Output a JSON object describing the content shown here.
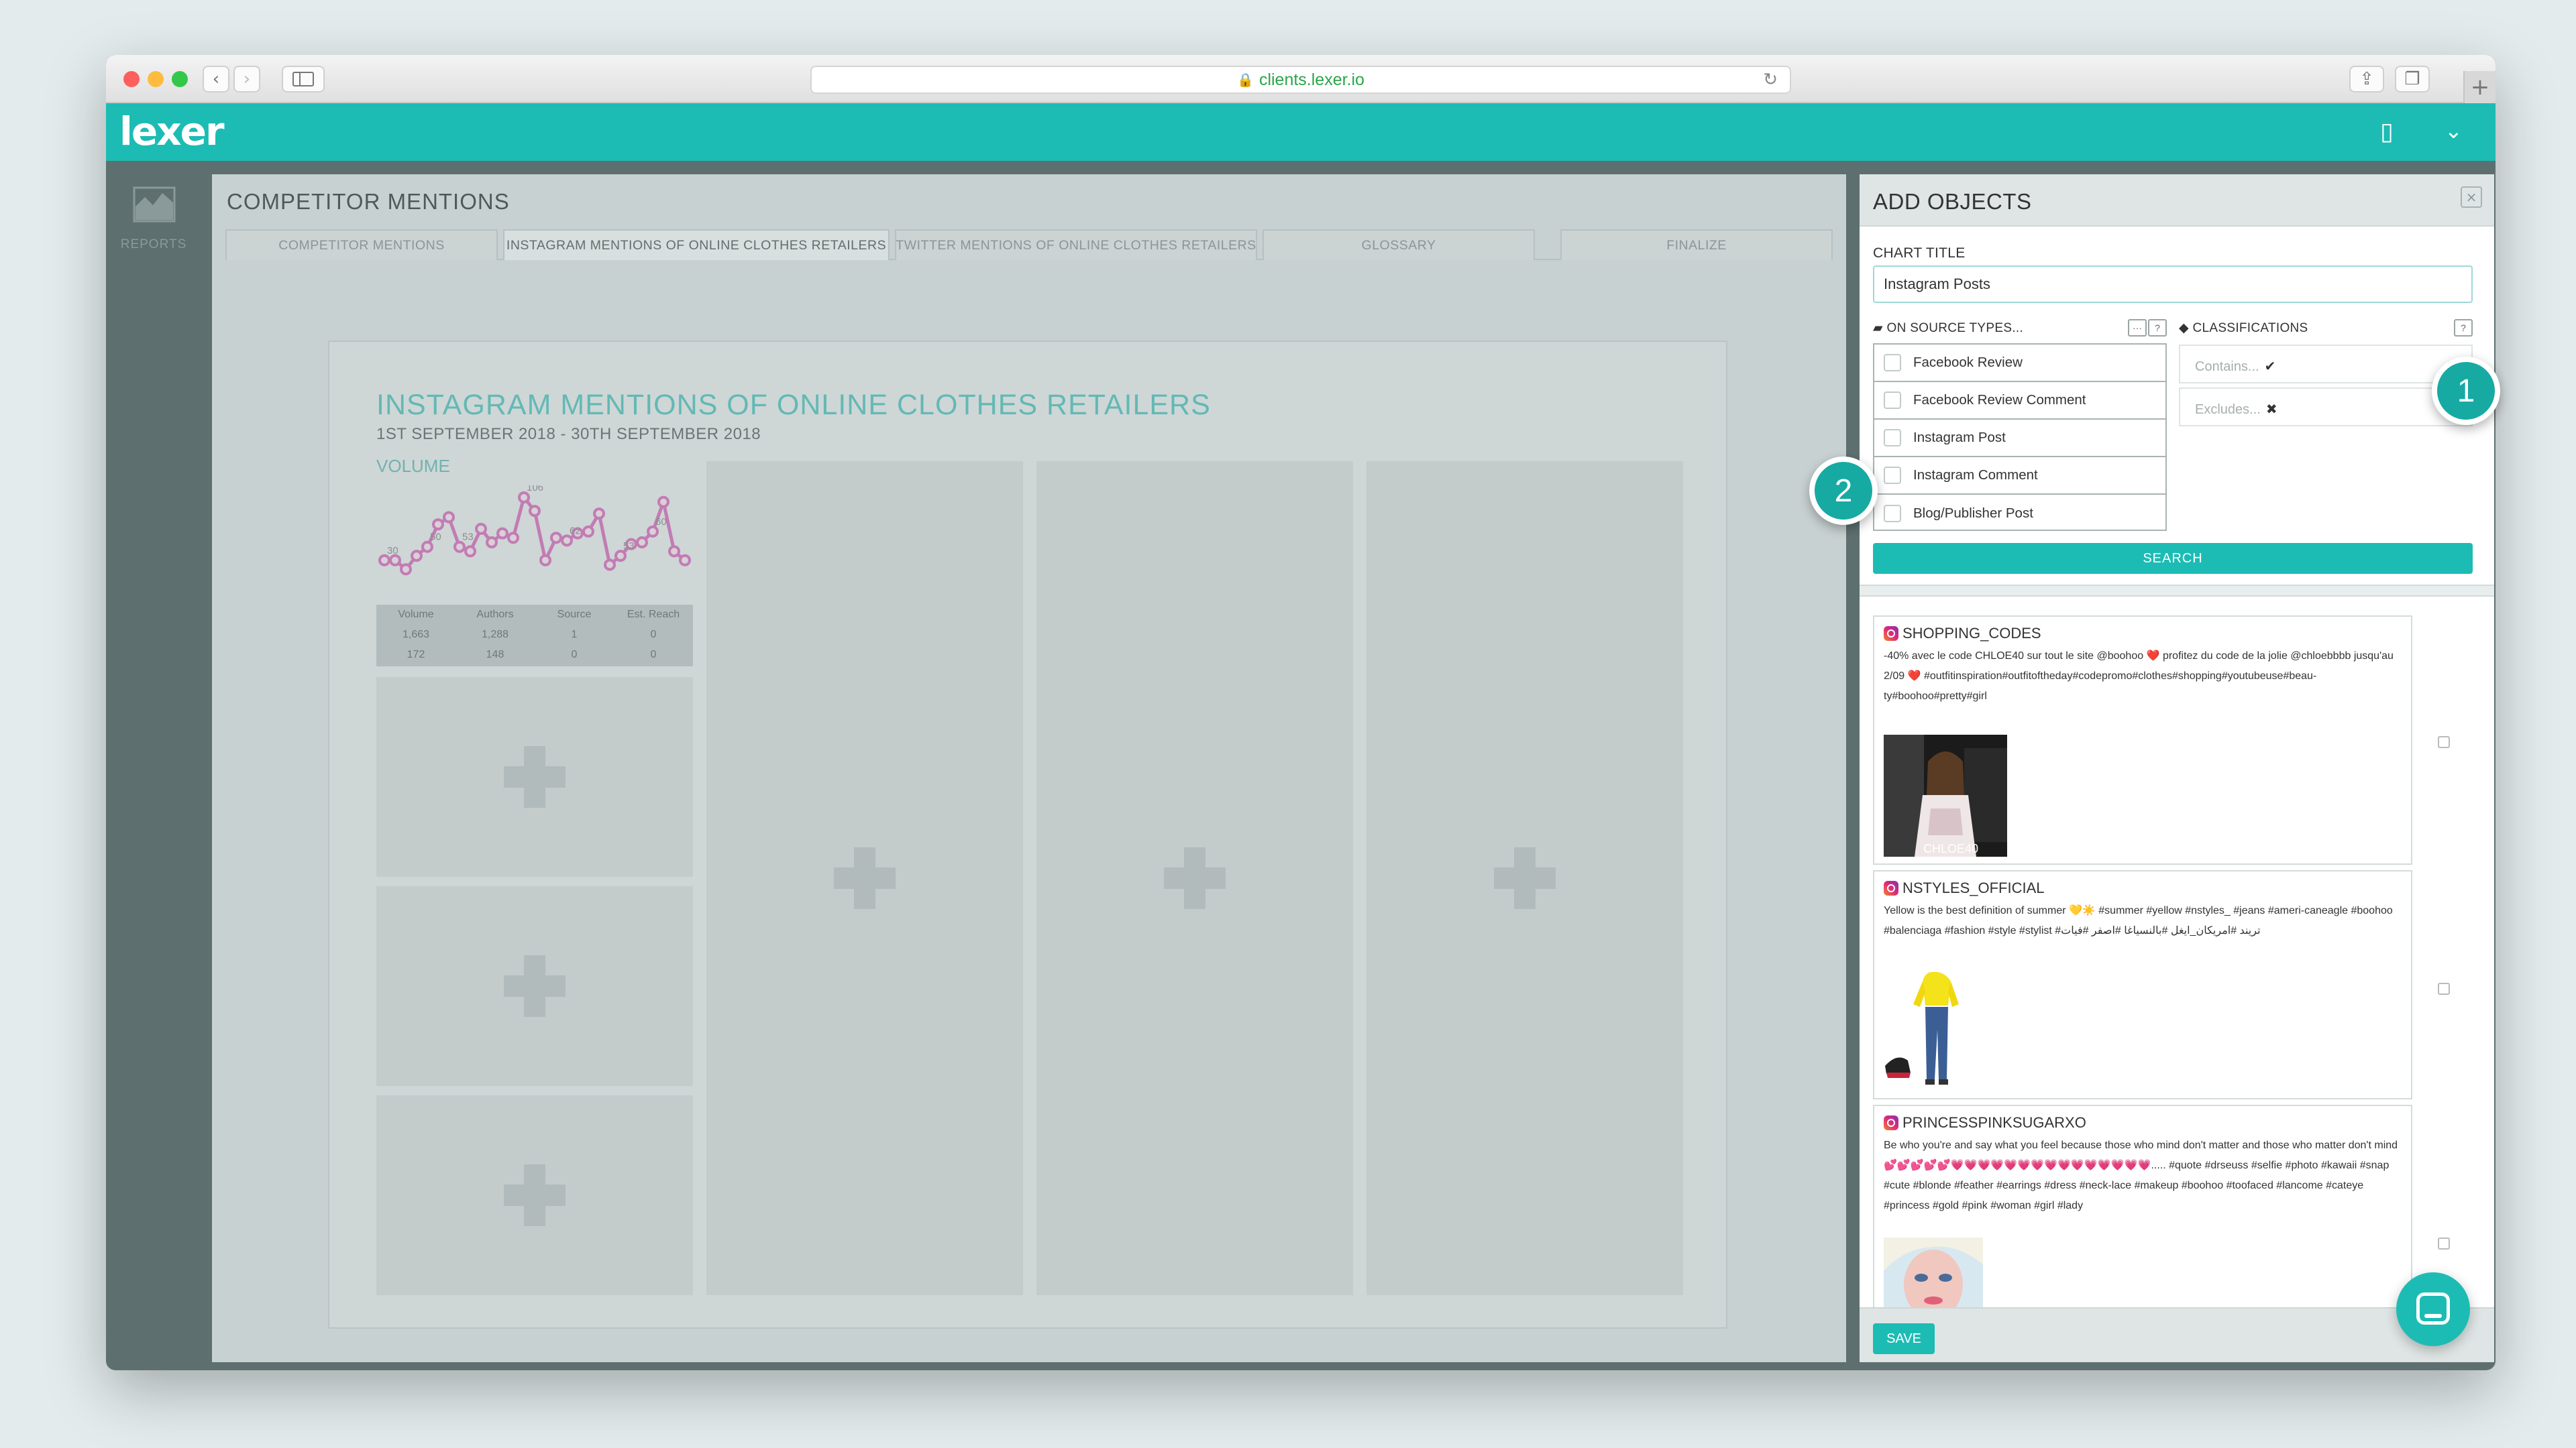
{
  "browser": {
    "url": "clients.lexer.io"
  },
  "app": {
    "logo": "lexer"
  },
  "sidebar": {
    "reports_label": "REPORTS"
  },
  "main": {
    "title": "COMPETITOR MENTIONS",
    "tabs": [
      {
        "label": "COMPETITOR MENTIONS"
      },
      {
        "label": "INSTAGRAM MENTIONS OF ONLINE CLOTHES RETAILERS"
      },
      {
        "label": "TWITTER MENTIONS OF ONLINE CLOTHES RETAILERS"
      },
      {
        "label": "GLOSSARY"
      },
      {
        "label": "FINALIZE"
      }
    ],
    "active_tab": 1,
    "report": {
      "title": "INSTAGRAM MENTIONS OF ONLINE CLOTHES RETAILERS",
      "date_range": "1ST SEPTEMBER 2018 - 30TH SEPTEMBER 2018",
      "widget_title": "VOLUME",
      "stats": {
        "headers": [
          "Volume",
          "Authors",
          "Source",
          "Est. Reach"
        ],
        "rows": [
          [
            "1,663",
            "1,288",
            "1",
            "0"
          ],
          [
            "172",
            "148",
            "0",
            "0"
          ]
        ]
      }
    }
  },
  "chart_data": {
    "type": "line",
    "title": "VOLUME",
    "series": [
      {
        "values": [
          30,
          30,
          20,
          35,
          45,
          70,
          78,
          45,
          40,
          65,
          50,
          60,
          55,
          100,
          85,
          30,
          55,
          52,
          60,
          62,
          82,
          25,
          35,
          48,
          50,
          62,
          95,
          40,
          30
        ]
      }
    ],
    "data_labels": [
      "30",
      "50",
      "53",
      "106",
      "62",
      "53",
      "60"
    ],
    "color": "#c27cb4"
  },
  "panel": {
    "title": "ADD OBJECTS",
    "close_icon": "×",
    "chart_title_label": "CHART TITLE",
    "chart_title_value": "Instagram Posts",
    "source_types_label": "ON SOURCE TYPES...",
    "source_more": "···",
    "help": "?",
    "classifications_label": "CLASSIFICATIONS",
    "source_types": [
      {
        "label": "Facebook Review"
      },
      {
        "label": "Facebook Review Comment"
      },
      {
        "label": "Instagram Post"
      },
      {
        "label": "Instagram Comment"
      },
      {
        "label": "Blog/Publisher Post"
      }
    ],
    "contains_label": "Contains...",
    "excludes_label": "Excludes...",
    "search_label": "SEARCH",
    "save_label": "SAVE",
    "posts": [
      {
        "user": "SHOPPING_CODES",
        "text": "-40% avec le code CHLOE40 sur tout le site @boohoo ❤️ profitez du code de la jolie @chloebbbb jusqu'au 2/09 ❤️ #outfitinspiration#outfitoftheday#codepromo#clothes#shopping#youtubeuse#beau-ty#boohoo#pretty#girl",
        "image_caption": "CHLOE40"
      },
      {
        "user": "NSTYLES_OFFICIAL",
        "text": "Yellow is the best definition of summer 💛☀️ #summer #yellow #nstyles_ #jeans #ameri-caneagle #boohoo #balenciaga #fashion #style #stylist #تريند #امريكان_ايغل #بالنسياغا #اصفر #فيات"
      },
      {
        "user": "PRINCESSPINKSUGARXO",
        "text": "Be who you're and say what you feel because those who mind don't matter and those who matter don't mind💕💕💕💕💕💗💗💗💗💗💗💗💗💗💗💗💗💗💗💗..... #quote #drseuss #selfie #photo #kawaii #snap #cute #blonde #feather #earrings #dress #neck-lace #makeup #boohoo #toofaced #lancome #cateye #princess #gold #pink #woman #girl #lady"
      }
    ]
  },
  "annotations": [
    {
      "label": "1"
    },
    {
      "label": "2"
    }
  ],
  "colors": {
    "brand": "#1cbcb4",
    "chart_line": "#c27cb4"
  }
}
